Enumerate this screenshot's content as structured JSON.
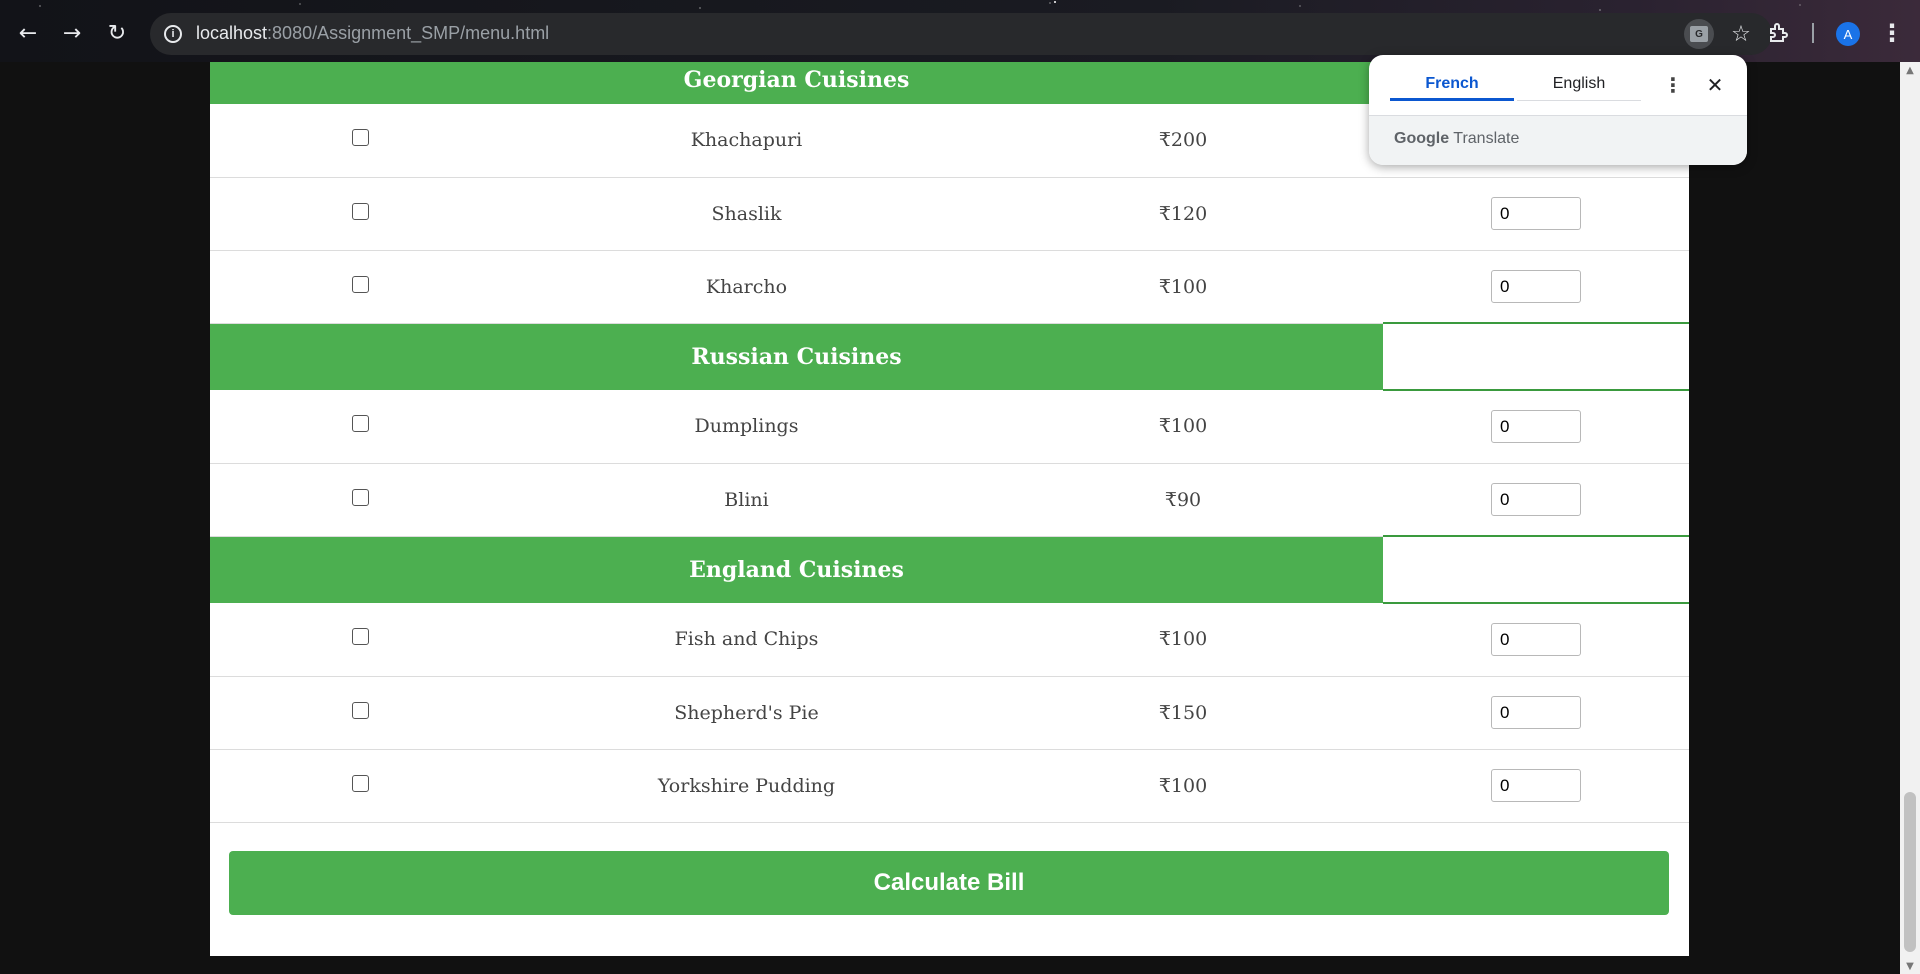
{
  "browser": {
    "url_host": "localhost",
    "url_path": ":8080/Assignment_SMP/menu.html",
    "profile_initial": "A",
    "icons": [
      "back-arrow-icon",
      "forward-arrow-icon",
      "reload-icon",
      "info-icon",
      "translate-icon",
      "star-icon",
      "extensions-icon",
      "more-vert-icon"
    ]
  },
  "translate_popup": {
    "tab_active": "French",
    "tab_other": "English",
    "brand_google": "Google",
    "brand_translate": "Translate"
  },
  "menu": {
    "categories": [
      {
        "name": "Georgian Cuisines",
        "items": [
          {
            "name": "Khachapuri",
            "price": "₹200",
            "qty": ""
          },
          {
            "name": "Shaslik",
            "price": "₹120",
            "qty": "0"
          },
          {
            "name": "Kharcho",
            "price": "₹100",
            "qty": "0"
          }
        ]
      },
      {
        "name": "Russian Cuisines",
        "items": [
          {
            "name": "Dumplings",
            "price": "₹100",
            "qty": "0"
          },
          {
            "name": "Blini",
            "price": "₹90",
            "qty": "0"
          }
        ]
      },
      {
        "name": "England Cuisines",
        "items": [
          {
            "name": "Fish and Chips",
            "price": "₹100",
            "qty": "0"
          },
          {
            "name": "Shepherd's Pie",
            "price": "₹150",
            "qty": "0"
          },
          {
            "name": "Yorkshire Pudding",
            "price": "₹100",
            "qty": "0"
          }
        ]
      }
    ],
    "calculate_label": "Calculate Bill"
  },
  "colors": {
    "accent_green": "#4caf50",
    "link_blue": "#0b57d0"
  }
}
